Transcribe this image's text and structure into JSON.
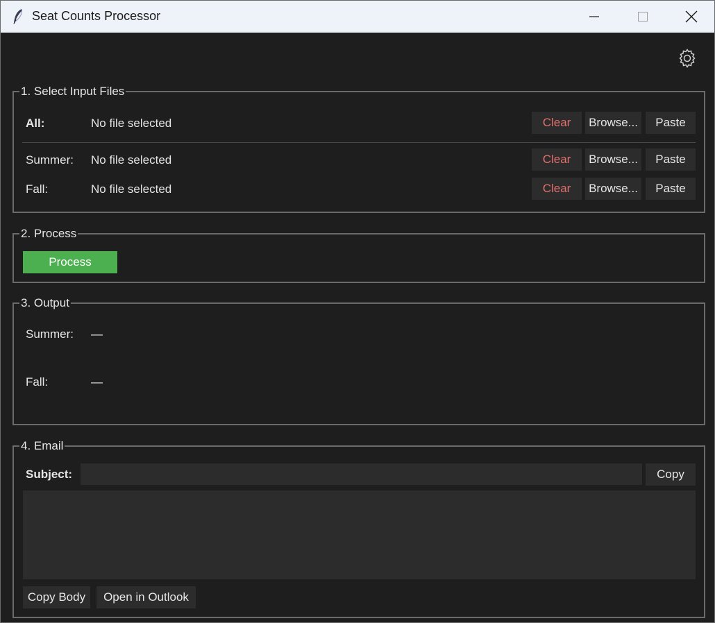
{
  "window": {
    "title": "Seat Counts Processor"
  },
  "select_input": {
    "legend": "1. Select Input Files",
    "rows": [
      {
        "label": "All:",
        "value": "No file selected"
      },
      {
        "label": "Summer:",
        "value": "No file selected"
      },
      {
        "label": "Fall:",
        "value": "No file selected"
      }
    ],
    "clear_label": "Clear",
    "browse_label": "Browse...",
    "paste_label": "Paste"
  },
  "process": {
    "legend": "2. Process",
    "button_label": "Process"
  },
  "output": {
    "legend": "3. Output",
    "rows": [
      {
        "label": "Summer:",
        "value": "—"
      },
      {
        "label": "Fall:",
        "value": "—"
      }
    ]
  },
  "email": {
    "legend": "4. Email",
    "subject_label": "Subject:",
    "subject_value": "",
    "copy_label": "Copy",
    "body_value": "",
    "copy_body_label": "Copy Body",
    "open_outlook_label": "Open in Outlook"
  },
  "icons": {
    "app": "feather-icon",
    "settings": "gear-icon",
    "minimize": "minimize-icon",
    "maximize": "maximize-icon",
    "close": "close-icon"
  },
  "colors": {
    "background": "#1e1e1e",
    "titlebar": "#eef2f9",
    "button": "#2c2c2c",
    "clear_text": "#e0706c",
    "process_button": "#4caf50",
    "group_border": "#6b6b6b"
  }
}
